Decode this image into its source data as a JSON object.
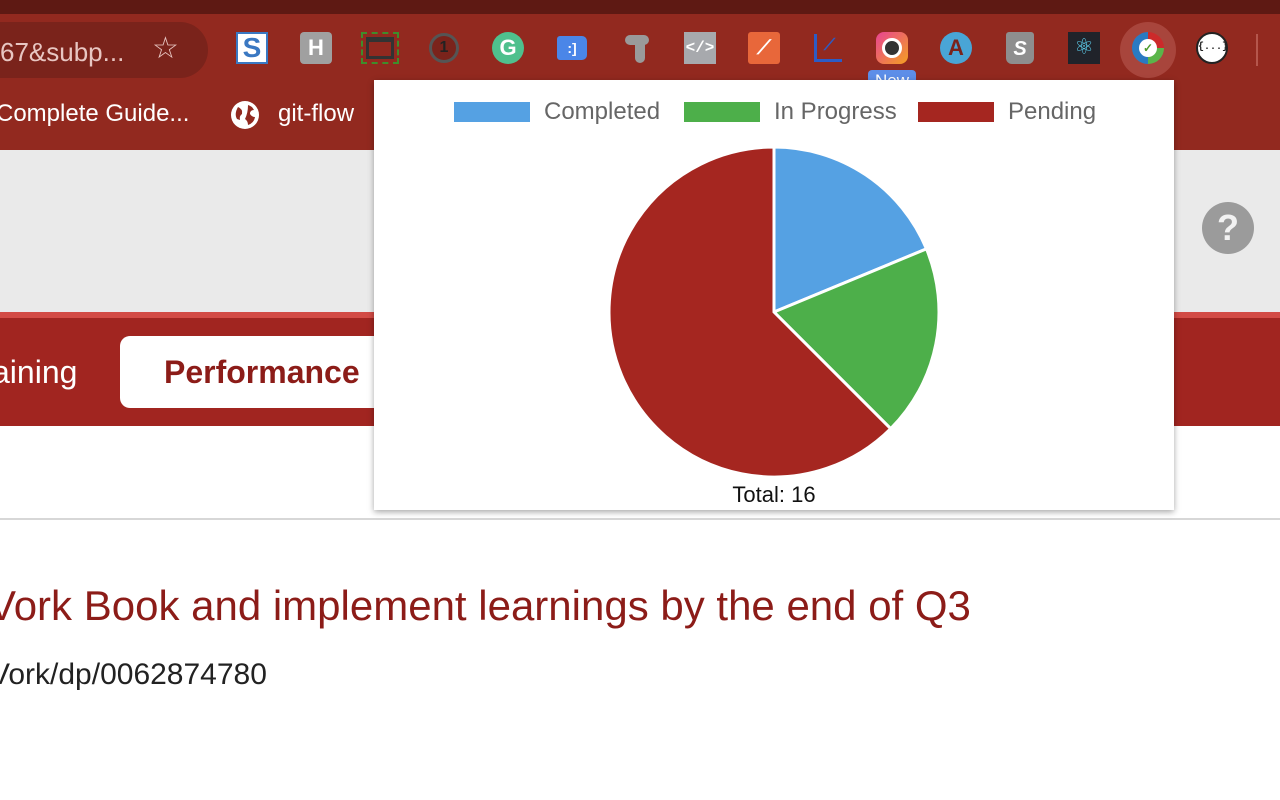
{
  "browser": {
    "omnibox_text": "67&subp...",
    "bookmark_icon": "star-icon",
    "extensions": [
      {
        "name": "s-extension-icon"
      },
      {
        "name": "h-extension-icon"
      },
      {
        "name": "window-resizer-icon"
      },
      {
        "name": "password-manager-icon"
      },
      {
        "name": "grammarly-icon"
      },
      {
        "name": "tag-assistant-icon"
      },
      {
        "name": "tag-manager-icon"
      },
      {
        "name": "code-viewer-icon"
      },
      {
        "name": "analytics-icon"
      },
      {
        "name": "chart-line-icon"
      },
      {
        "name": "camera-icon"
      },
      {
        "name": "amplitude-icon"
      },
      {
        "name": "shopify-icon"
      },
      {
        "name": "react-devtools-icon"
      },
      {
        "name": "performance-extension-icon"
      },
      {
        "name": "json-viewer-icon"
      }
    ],
    "new_badge": "New",
    "bookmarks": [
      {
        "label": "Complete Guide..."
      },
      {
        "label": "git-flow"
      }
    ]
  },
  "page": {
    "help_label": "?",
    "nav_tabs": [
      {
        "label": "aining"
      },
      {
        "label": "Performance",
        "active": true
      }
    ],
    "goal_title": "Vork Book and implement learnings by the end of Q3",
    "goal_link": "Vork/dp/0062874780"
  },
  "popup": {
    "total_label": "Total: 16"
  },
  "chart_data": {
    "type": "pie",
    "title": "",
    "categories": [
      "Completed",
      "In Progress",
      "Pending"
    ],
    "values": [
      3,
      3,
      10
    ],
    "colors": [
      "#55a1e3",
      "#4daf4a",
      "#a52620"
    ],
    "legend_position": "top",
    "start_angle": "12 o'clock, clockwise",
    "total": 16
  }
}
